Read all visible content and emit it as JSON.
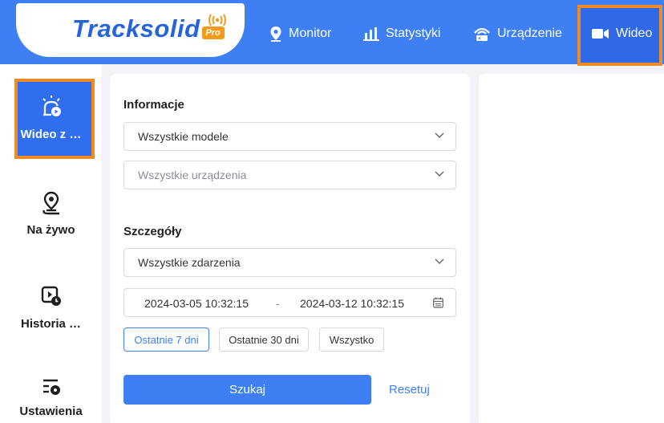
{
  "brand": {
    "logo_text": "Tracksolid",
    "logo_badge": "Pro"
  },
  "topnav": {
    "items": [
      {
        "label": "Monitor",
        "icon": "location-pin-icon"
      },
      {
        "label": "Statystyki",
        "icon": "bar-chart-icon"
      },
      {
        "label": "Urządzenie",
        "icon": "device-icon"
      },
      {
        "label": "Wideo",
        "icon": "video-camera-icon",
        "active": true
      }
    ]
  },
  "sidebar": {
    "items": [
      {
        "label": "Wideo z …",
        "icon": "alarm-video-icon",
        "active": true
      },
      {
        "label": "Na żywo",
        "icon": "live-location-icon"
      },
      {
        "label": "Historia …",
        "icon": "playback-history-icon"
      },
      {
        "label": "Ustawienia",
        "icon": "settings-icon"
      }
    ]
  },
  "filters": {
    "info_title": "Informacje",
    "model_select": "Wszystkie modele",
    "device_select_placeholder": "Wszystkie urządzenia",
    "details_title": "Szczegóły",
    "event_select": "Wszystkie zdarzenia",
    "date_start": "2024-03-05 10:32:15",
    "date_separator": "-",
    "date_end": "2024-03-12 10:32:15",
    "quick_ranges": [
      {
        "label": "Ostatnie 7 dni",
        "active": true
      },
      {
        "label": "Ostatnie 30 dni",
        "active": false
      },
      {
        "label": "Wszystko",
        "active": false
      }
    ],
    "search_label": "Szukaj",
    "reset_label": "Resetuj"
  },
  "colors": {
    "primary": "#3e80f4",
    "highlight_border": "#f08a27",
    "logo_badge": "#f39a1d"
  }
}
